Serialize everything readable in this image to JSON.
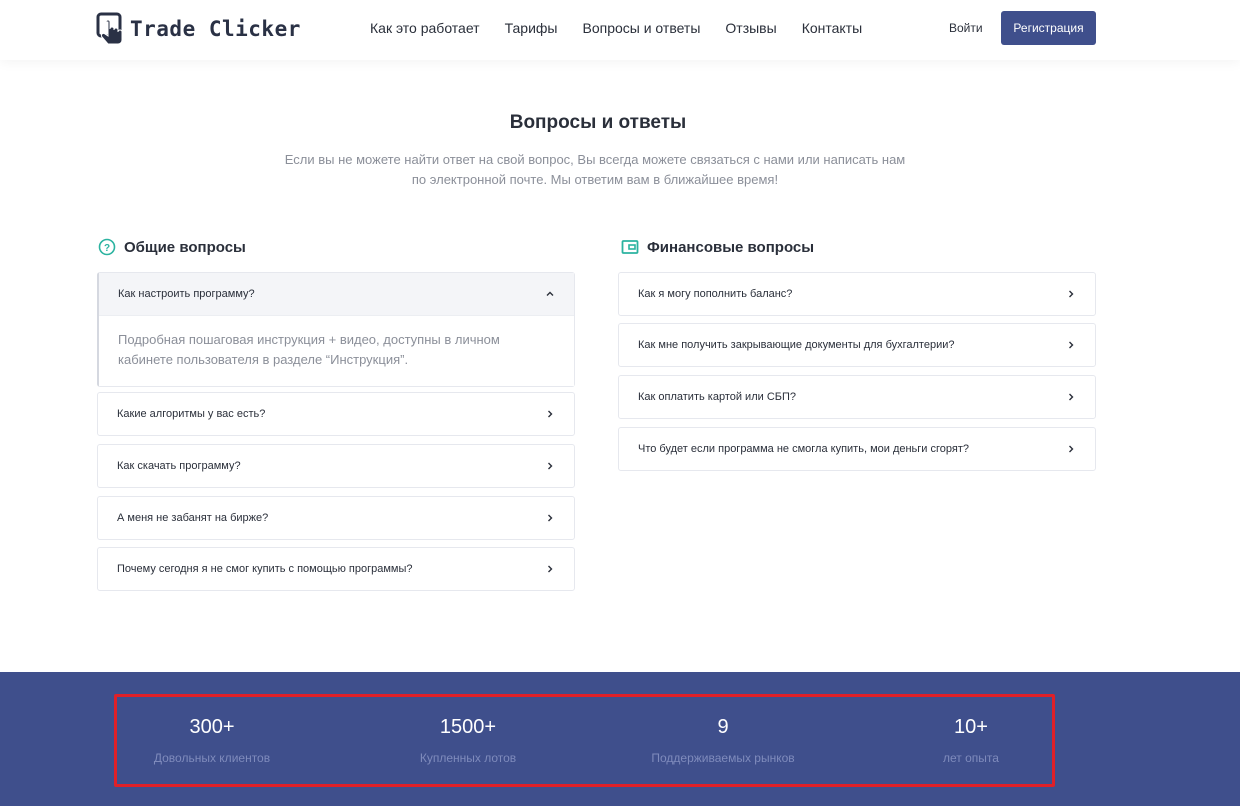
{
  "header": {
    "brand": "Trade Clicker",
    "nav": [
      "Как это работает",
      "Тарифы",
      "Вопросы и ответы",
      "Отзывы",
      "Контакты"
    ],
    "login_label": "Войти",
    "register_label": "Регистрация"
  },
  "faq": {
    "title": "Вопросы и ответы",
    "subtitle_line1": "Если вы не можете найти ответ на свой вопрос, Вы всегда можете связаться с нами или написать нам",
    "subtitle_line2": "по электронной почте. Мы ответим вам в ближайшее время!",
    "general": {
      "heading": "Общие вопросы",
      "items": [
        {
          "q": "Как настроить программу?",
          "a_line1": "Подробная пошаговая инструкция + видео, доступны в личном",
          "a_line2": "кабинете пользователя в разделе “Инструкция”."
        },
        {
          "q": "Какие алгоритмы у вас есть?"
        },
        {
          "q": "Как скачать программу?"
        },
        {
          "q": "А меня не забанят на бирже?"
        },
        {
          "q": "Почему сегодня я не смог купить с помощью программы?"
        }
      ]
    },
    "finance": {
      "heading": "Финансовые вопросы",
      "items": [
        {
          "q": "Как я могу пополнить баланс?"
        },
        {
          "q": "Как мне получить закрывающие документы для бухгалтерии?"
        },
        {
          "q": "Как оплатить картой или СБП?"
        },
        {
          "q": "Что будет если программа не смогла купить, мои деньги сгорят?"
        }
      ]
    }
  },
  "stats": [
    {
      "value": "300+",
      "label": "Довольных клиентов"
    },
    {
      "value": "1500+",
      "label": "Купленных лотов"
    },
    {
      "value": "9",
      "label": "Поддерживаемых рынков"
    },
    {
      "value": "10+",
      "label": "лет опыта"
    }
  ],
  "colors": {
    "brand": "#3f4f8c",
    "accent_teal": "#2bb3a0",
    "highlight_border": "#e02028"
  }
}
